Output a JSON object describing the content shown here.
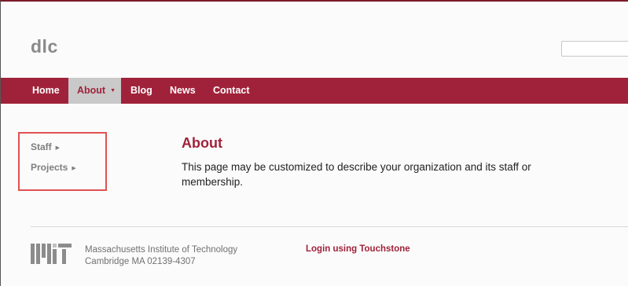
{
  "header": {
    "site_name": "dlc",
    "search_placeholder": ""
  },
  "nav": {
    "items": [
      {
        "label": "Home",
        "active": false
      },
      {
        "label": "About",
        "active": true,
        "has_dropdown": true
      },
      {
        "label": "Blog",
        "active": false
      },
      {
        "label": "News",
        "active": false
      },
      {
        "label": "Contact",
        "active": false
      }
    ],
    "caret_icon": "caret-down-icon"
  },
  "sidebar": {
    "items": [
      {
        "label": "Staff",
        "icon": "arrow-right-icon"
      },
      {
        "label": "Projects",
        "icon": "arrow-right-icon"
      }
    ]
  },
  "main": {
    "title": "About",
    "body": "This page may be customized to describe your organization and its staff or membership."
  },
  "footer": {
    "logo_icon": "mit-logo",
    "address_line1": "Massachusetts Institute of Technology",
    "address_line2": "Cambridge MA 02139-4307",
    "login_label": "Login using Touchstone"
  },
  "colors": {
    "brand": "#a0223a",
    "active_nav_bg": "#c9c9c9",
    "highlight_box": "#e05252"
  }
}
